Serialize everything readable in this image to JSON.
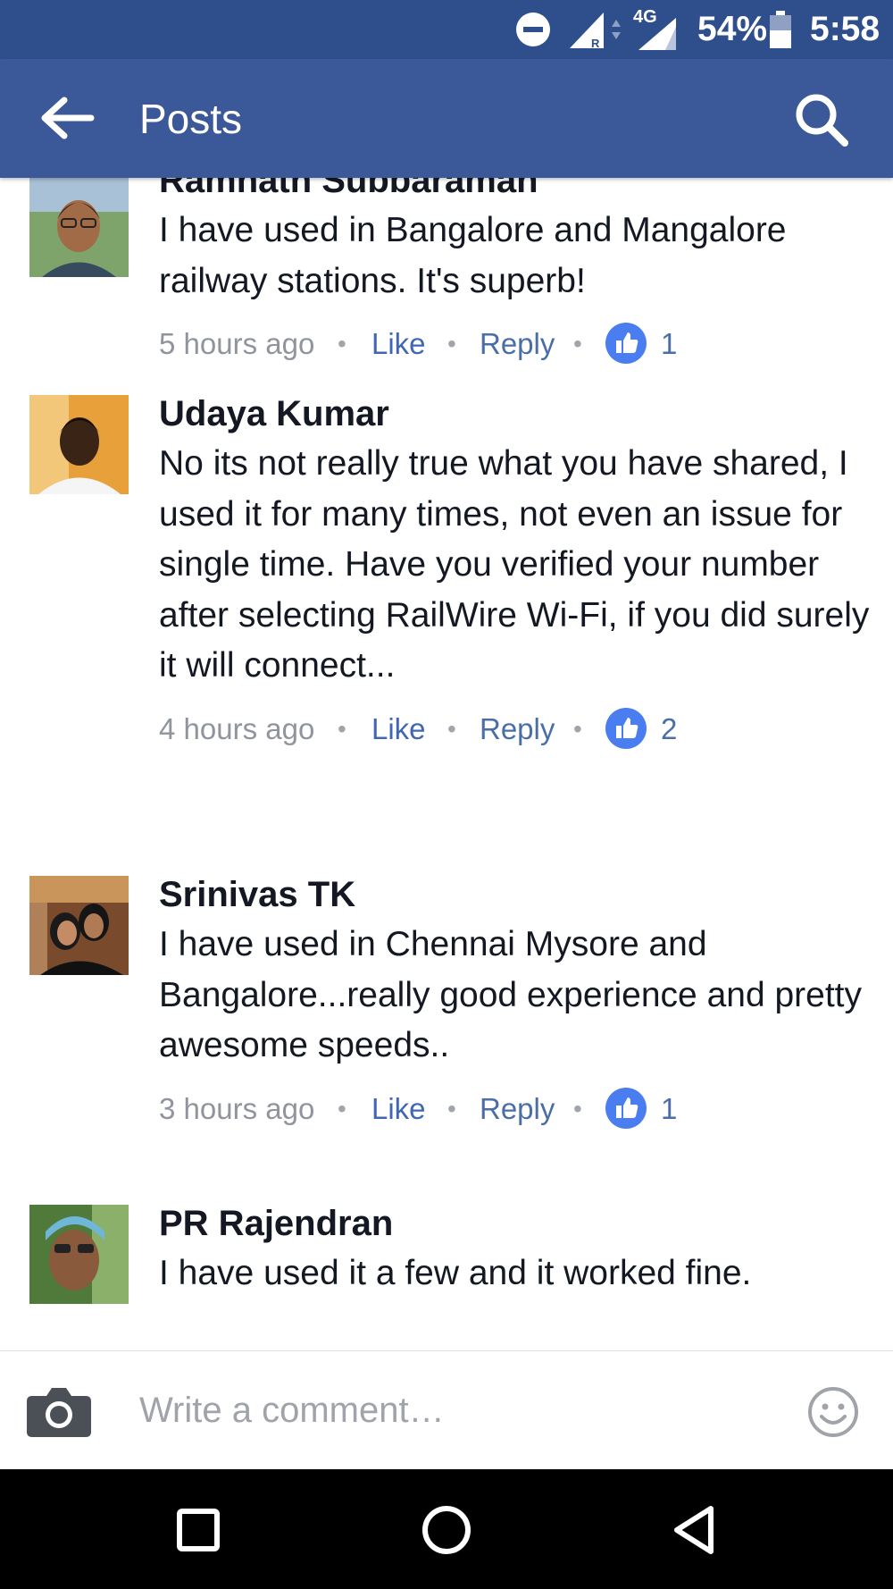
{
  "status_bar": {
    "battery": "54%",
    "time": "5:58",
    "network": "4G",
    "roaming": "R"
  },
  "app_bar": {
    "title": "Posts"
  },
  "comments": [
    {
      "author": "Ramnath Subbaraman",
      "text": "I have used in Bangalore and Mangalore railway stations. It's superb!",
      "time": "5 hours ago",
      "like_label": "Like",
      "reply_label": "Reply",
      "like_count": "1"
    },
    {
      "author": "Udaya Kumar",
      "text": "No its not really true what you have shared, I used it for many times, not even an issue for single time. Have you verified your number after selecting RailWire Wi-Fi, if you did surely it will connect...",
      "time": "4 hours ago",
      "like_label": "Like",
      "reply_label": "Reply",
      "like_count": "2"
    },
    {
      "author": "Srinivas TK",
      "text": "I have used in Chennai Mysore and Bangalore...really good experience and pretty awesome speeds..",
      "time": "3 hours ago",
      "like_label": "Like",
      "reply_label": "Reply",
      "like_count": "1"
    },
    {
      "author": "PR Rajendran",
      "text": "I have used it a few and it worked fine."
    }
  ],
  "composer": {
    "placeholder": "Write a comment…"
  },
  "colors": {
    "status_bar": "#2f4f8c",
    "app_bar": "#3b5998",
    "link": "#4267b2",
    "like_badge": "#4a7ef0",
    "nav_bar": "#000000"
  }
}
